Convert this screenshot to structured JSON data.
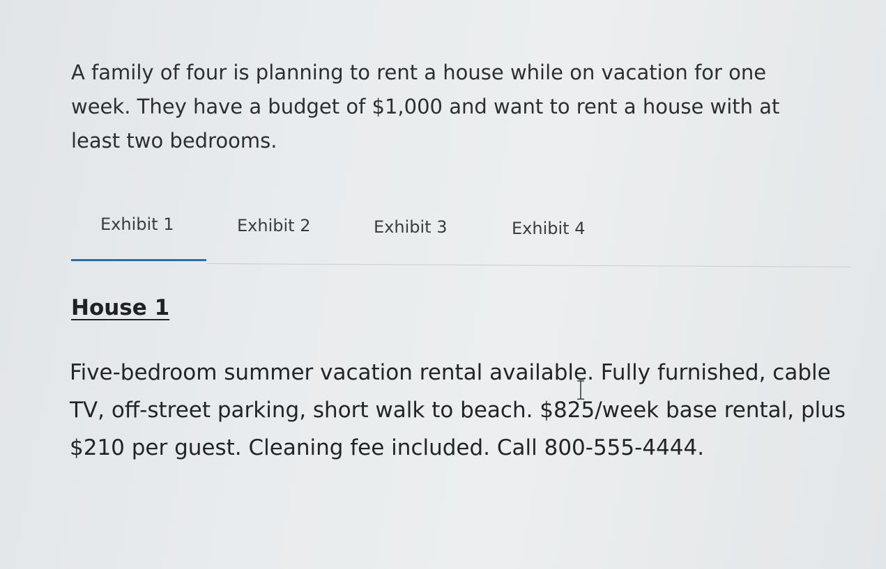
{
  "question": {
    "intro_text": "A family of four is planning to rent a house while on vacation for one week. They have a budget of $1,000 and want to rent a house with at least two bedrooms."
  },
  "tabs": [
    {
      "label": "Exhibit 1",
      "active": true
    },
    {
      "label": "Exhibit 2",
      "active": false
    },
    {
      "label": "Exhibit 3",
      "active": false
    },
    {
      "label": "Exhibit 4",
      "active": false
    }
  ],
  "exhibit": {
    "title": "House 1",
    "description": "Five-bedroom summer vacation rental available. Fully furnished, cable TV, off-street parking, short walk to beach. $825/week base rental, plus $210 per guest. Cleaning fee included. Call 800-555-4444."
  },
  "colors": {
    "accent": "#2e6da4",
    "text": "#2c2e31",
    "background": "#e9ecee"
  },
  "icons": {
    "cursor": "text-cursor-icon"
  }
}
